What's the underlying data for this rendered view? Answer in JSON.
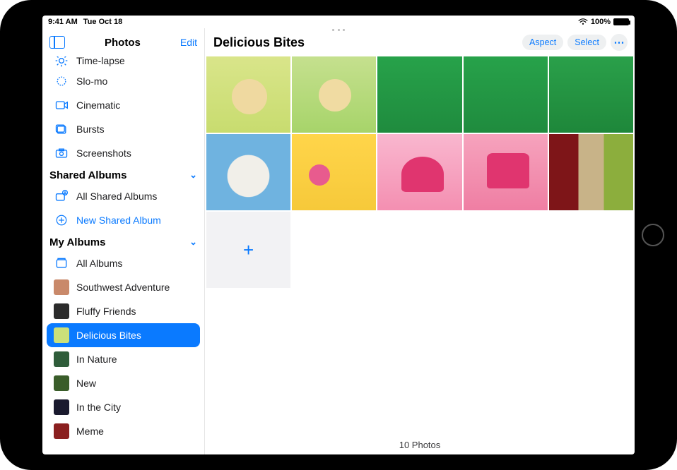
{
  "status": {
    "time": "9:41 AM",
    "date": "Tue Oct 18",
    "battery_pct": "100%"
  },
  "sidebar": {
    "app_title": "Photos",
    "edit_label": "Edit",
    "media_types": [
      {
        "name": "timelapse",
        "label": "Time-lapse"
      },
      {
        "name": "slomo",
        "label": "Slo-mo"
      },
      {
        "name": "cinematic",
        "label": "Cinematic"
      },
      {
        "name": "bursts",
        "label": "Bursts"
      },
      {
        "name": "screenshots",
        "label": "Screenshots"
      }
    ],
    "shared_section_title": "Shared Albums",
    "shared_items": [
      {
        "name": "all-shared",
        "label": "All Shared Albums"
      },
      {
        "name": "new-shared",
        "label": "New Shared Album"
      }
    ],
    "my_section_title": "My Albums",
    "my_albums": [
      {
        "name": "all-albums",
        "label": "All Albums",
        "thumb_color": ""
      },
      {
        "name": "southwest",
        "label": "Southwest Adventure",
        "thumb_color": "#c9896a"
      },
      {
        "name": "fluffy",
        "label": "Fluffy Friends",
        "thumb_color": "#2b2b2b"
      },
      {
        "name": "delicious",
        "label": "Delicious Bites",
        "thumb_color": "#cbe07a",
        "selected": true
      },
      {
        "name": "in-nature",
        "label": "In Nature",
        "thumb_color": "#2f5d3a"
      },
      {
        "name": "new",
        "label": "New",
        "thumb_color": "#3a5d2a"
      },
      {
        "name": "in-city",
        "label": "In the City",
        "thumb_color": "#1a1a2e"
      },
      {
        "name": "meme",
        "label": "Meme",
        "thumb_color": "#8a1f1f"
      }
    ]
  },
  "main": {
    "album_title": "Delicious Bites",
    "aspect_label": "Aspect",
    "select_label": "Select",
    "footer_count": "10 Photos",
    "add_tile_glyph": "+"
  }
}
